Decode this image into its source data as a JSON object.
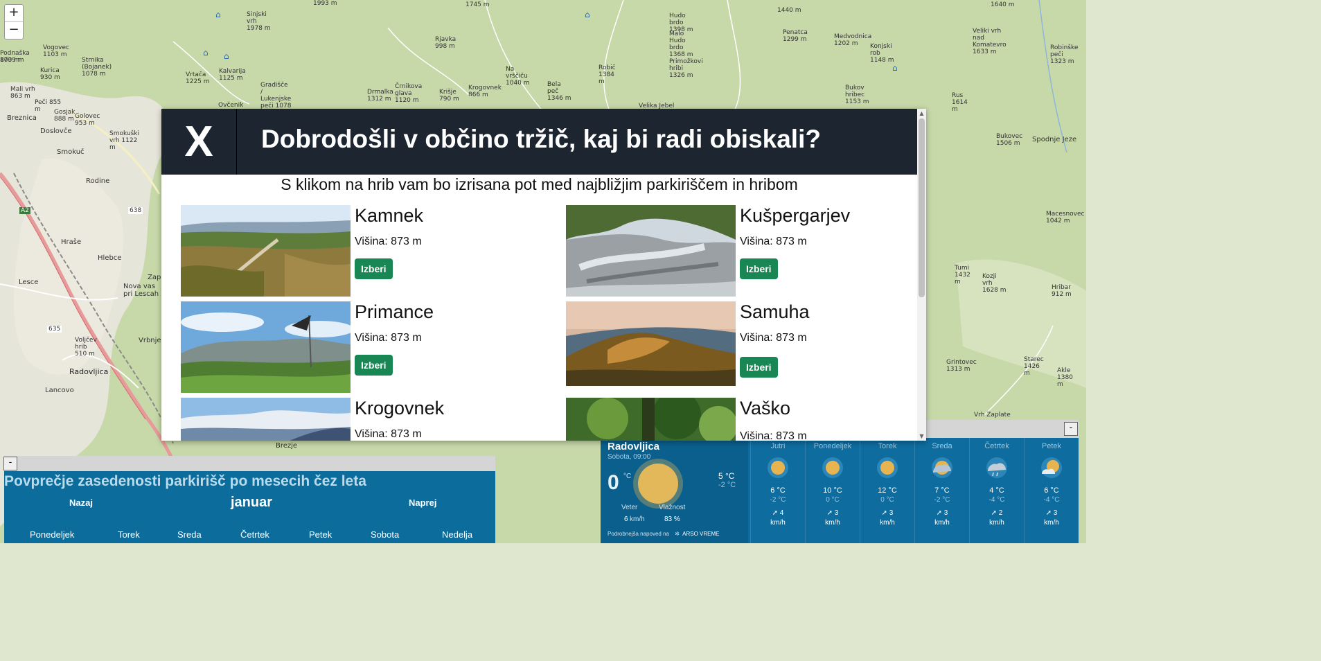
{
  "map": {
    "zoom_in": "+",
    "zoom_out": "−",
    "places": [
      {
        "name": "Breznica"
      },
      {
        "name": "Doslovče"
      },
      {
        "name": "Smokuč"
      },
      {
        "name": "Rodine"
      },
      {
        "name": "Hraše"
      },
      {
        "name": "Hlebce"
      },
      {
        "name": "Lesce"
      },
      {
        "name": "Nova vas pri Lescah"
      },
      {
        "name": "Vrbnje"
      },
      {
        "name": "Radovljica"
      },
      {
        "name": "Lancovo"
      },
      {
        "name": "Brezje"
      },
      {
        "name": "Zapu"
      },
      {
        "name": "Spodnje Jeze"
      },
      {
        "name": "Velika Jebel"
      },
      {
        "name": "Vogovec 1103 m"
      },
      {
        "name": "Kurica 930 m"
      },
      {
        "name": "Strnika (Bojanek) 1078 m"
      },
      {
        "name": "Mali vrh 863 m"
      },
      {
        "name": "Peči 855 m"
      },
      {
        "name": "Gosjak 888 m"
      },
      {
        "name": "Golovec 953 m"
      },
      {
        "name": "Smokuški vrh 1122 m"
      },
      {
        "name": "Sinjski vrh 1978 m"
      },
      {
        "name": "Kalvarija 1125 m"
      },
      {
        "name": "Vrtača 1225 m"
      },
      {
        "name": "Gradišče / Lukenjske peči 1078 m"
      },
      {
        "name": "Ovčenik"
      },
      {
        "name": "Drmalka 1312 m"
      },
      {
        "name": "Črnikova glava 1120 m"
      },
      {
        "name": "Krišje 790 m"
      },
      {
        "name": "Rjavka 998 m"
      },
      {
        "name": "Krogovnek 866 m"
      },
      {
        "name": "Na vrščiču 1040 m"
      },
      {
        "name": "Bela peč 1346 m"
      },
      {
        "name": "Robič 1384 m"
      },
      {
        "name": "Hudo brdo 1398 m"
      },
      {
        "name": "Malo Hudo brdo 1368 m"
      },
      {
        "name": "Primožkovi hribi 1326 m"
      },
      {
        "name": "Penatca 1299 m"
      },
      {
        "name": "Medvodnica 1202 m"
      },
      {
        "name": "Konjski rob 1148 m"
      },
      {
        "name": "Bukov hribec 1153 m"
      },
      {
        "name": "Veliki vrh nad Komatevro 1633 m"
      },
      {
        "name": "Robinške peči 1323 m"
      },
      {
        "name": "Rus 1614 m"
      },
      {
        "name": "Bukovec 1506 m"
      },
      {
        "name": "Macesnovec 1042 m"
      },
      {
        "name": "Tumi 1432 m"
      },
      {
        "name": "Kozji vrh 1628 m"
      },
      {
        "name": "Hribar 912 m"
      },
      {
        "name": "Grintovec 1313 m"
      },
      {
        "name": "Starec 1426 m"
      },
      {
        "name": "Akle 1380 m"
      },
      {
        "name": "Vrh Zaplate"
      },
      {
        "name": "638"
      },
      {
        "name": "635"
      },
      {
        "name": "A2"
      },
      {
        "name": "Voljčev hrib 510 m"
      },
      {
        "name": "1993 m"
      },
      {
        "name": "1745 m"
      },
      {
        "name": "1640 m"
      },
      {
        "name": "1440 m"
      },
      {
        "name": "873 m"
      },
      {
        "name": "Podnaška 1009 m"
      }
    ]
  },
  "modal": {
    "close_label": "X",
    "title": "Dobrodošli v občino tržič, kaj bi radi obiskali?",
    "subtitle": "S klikom na hrib vam bo izrisana pot med najbližjim parkiriščem in hribom",
    "cards": [
      {
        "name": "Kamnek",
        "height": "Višina: 873 m",
        "button": "Izberi",
        "photo": "mountain-photo"
      },
      {
        "name": "Kušpergarjev",
        "height": "Višina: 873 m",
        "button": "Izberi",
        "photo": "mountain-photo"
      },
      {
        "name": "Primance",
        "height": "Višina: 873 m",
        "button": "Izberi",
        "photo": "mountain-photo"
      },
      {
        "name": "Samuha",
        "height": "Višina: 873 m",
        "button": "Izberi",
        "photo": "mountain-photo"
      },
      {
        "name": "Krogovnek",
        "height": "Višina: 873 m",
        "button": "Izberi",
        "photo": "mountain-photo"
      },
      {
        "name": "Vaško",
        "height": "Višina: 873 m",
        "button": "Izberi",
        "photo": "mountain-photo"
      }
    ]
  },
  "parking": {
    "minimize_label": "-",
    "title": "Povprečje zasedenosti parkirišč po mesecih čez leta",
    "prev_label": "Nazaj",
    "next_label": "Naprej",
    "month": "januar",
    "weekdays": [
      "Ponedeljek",
      "Torek",
      "Sreda",
      "Četrtek",
      "Petek",
      "Sobota",
      "Nedelja"
    ]
  },
  "weather": {
    "minimize_label": "-",
    "city": "Radovljica",
    "date": "Sobota, 09:00",
    "current_temp": "0",
    "current_unit": "°C",
    "today_max": "5 °C",
    "today_min": "-2 °C",
    "wind_label": "Veter",
    "wind_value": "6",
    "wind_unit": "km/h",
    "humidity_label": "Vlažnost",
    "humidity_value": "83 %",
    "footer_text": "Podrobnejša napoved na",
    "footer_brand": "ARSO VREME",
    "accent_color": "#0f6c9f",
    "days": [
      {
        "name": "Jutri",
        "icon": "sun-icon",
        "max": "6 °C",
        "min": "-2 °C",
        "wind": "4",
        "unit": "km/h"
      },
      {
        "name": "Ponedeljek",
        "icon": "sun-icon",
        "max": "10 °C",
        "min": "0 °C",
        "wind": "3",
        "unit": "km/h"
      },
      {
        "name": "Torek",
        "icon": "sun-icon",
        "max": "12 °C",
        "min": "0 °C",
        "wind": "3",
        "unit": "km/h"
      },
      {
        "name": "Sreda",
        "icon": "cloudy-icon",
        "max": "7 °C",
        "min": "-2 °C",
        "wind": "3",
        "unit": "km/h"
      },
      {
        "name": "Četrtek",
        "icon": "cloud-rain-icon",
        "max": "4 °C",
        "min": "-4 °C",
        "wind": "2",
        "unit": "km/h"
      },
      {
        "name": "Petek",
        "icon": "partly-cloudy-icon",
        "max": "6 °C",
        "min": "-4 °C",
        "wind": "3",
        "unit": "km/h"
      }
    ]
  }
}
